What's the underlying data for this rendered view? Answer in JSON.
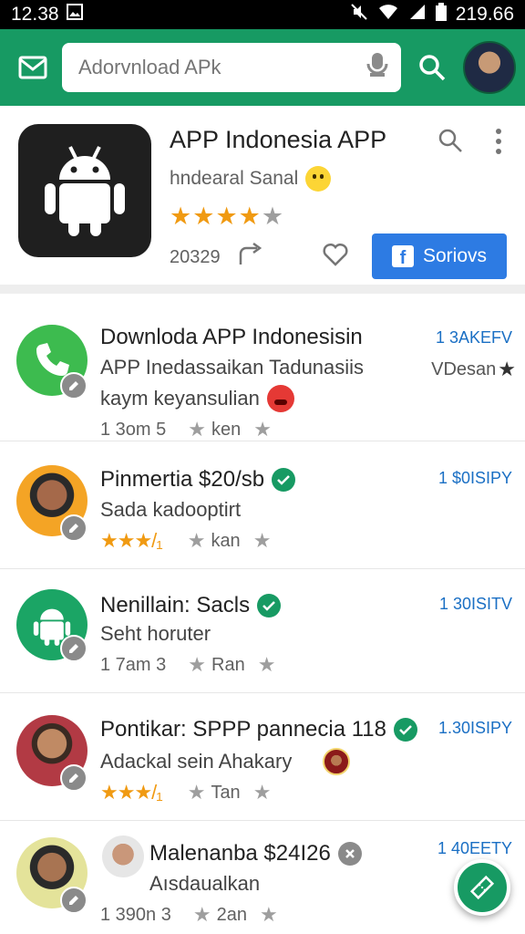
{
  "status_bar": {
    "time": "12.38",
    "battery_text": "219.66"
  },
  "search": {
    "placeholder": "Adorvnload APk"
  },
  "featured": {
    "title": "APP Indonesia APP",
    "subtitle": "hndearal Sanal",
    "rating": 4,
    "rating_max": 5,
    "count": "20329",
    "button_label": "Soriovs"
  },
  "items": [
    {
      "title": "Downloda APP Indonesisin",
      "line2": "APP Inedassaikan Tadunasiis",
      "line3": "kaym keyansulian",
      "meta_left": "1 3om 5",
      "meta_mid": "ken",
      "price": "1 3AKEFV",
      "right_sub": "VDesan"
    },
    {
      "title": "Pinmertia $20/sb",
      "line2": "Sada kadooptirt",
      "rating_text": "★★★/₁",
      "meta_mid": "kan",
      "price": "1 $0ISIPY"
    },
    {
      "title": "Nenillain: Sacls",
      "line2": "Seht horuter",
      "meta_left": "1 7am 3",
      "meta_mid": "Ran",
      "price": "1 30ISITV"
    },
    {
      "title": "Pontikar: SPPP pannecia 118",
      "line2": "Adackal sein Ahakary",
      "rating_text": "★★★/₁",
      "meta_mid": "Tan",
      "price": "1.30ISIPY"
    },
    {
      "title": "Malenanba $24I26",
      "line2": "Aısdaualkan",
      "meta_left": "1 390n 3",
      "meta_mid": "2an",
      "price": "1 40EETY"
    }
  ],
  "colors": {
    "primary": "#179a63",
    "accent_blue": "#2d7be3",
    "star": "#f09a12"
  },
  "icons": [
    "mail-icon",
    "mic-icon",
    "search-icon",
    "more-vert-icon",
    "heart-icon",
    "share-icon",
    "check-icon",
    "edit-icon",
    "close-icon",
    "star-icon"
  ]
}
